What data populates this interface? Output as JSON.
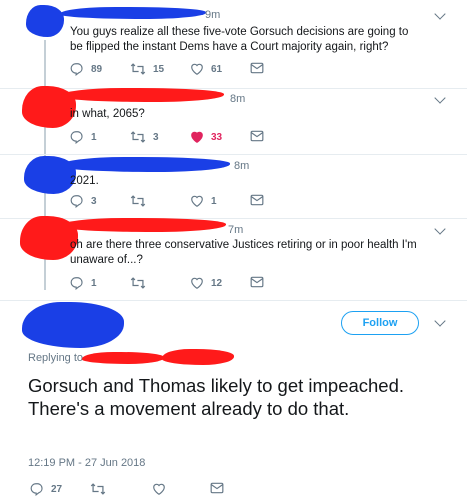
{
  "tweets": [
    {
      "time": "9m",
      "text": "You guys realize all these five-vote Gorsuch decisions are going to be flipped the instant Dems have a Court majority again, right?",
      "replies": "89",
      "retweets": "15",
      "likes": "61",
      "liked": false,
      "redaction_color": "#1a3fe6"
    },
    {
      "time": "8m",
      "text": "in what, 2065?",
      "replies": "1",
      "retweets": "3",
      "likes": "33",
      "liked": true,
      "redaction_color": "#ff1a1a"
    },
    {
      "time": "8m",
      "text": "2021.",
      "replies": "3",
      "retweets": "",
      "likes": "1",
      "liked": false,
      "redaction_color": "#1a3fe6"
    },
    {
      "time": "7m",
      "text": "oh are there three conservative Justices retiring or in poor health I'm unaware of...?",
      "replies": "1",
      "retweets": "",
      "likes": "12",
      "liked": false,
      "redaction_color": "#ff1a1a"
    }
  ],
  "main": {
    "follow_label": "Follow",
    "replying_to": "Replying to",
    "text": "Gorsuch and Thomas likely to get impeached. There's a movement already to do that.",
    "timestamp": "12:19 PM - 27 Jun 2018",
    "replies": "27"
  },
  "colors": {
    "accent": "#1da1f2",
    "like": "#e0245e",
    "muted": "#657786"
  },
  "icons": [
    "reply-icon",
    "retweet-icon",
    "like-icon",
    "mail-icon",
    "chevron-down-icon"
  ]
}
